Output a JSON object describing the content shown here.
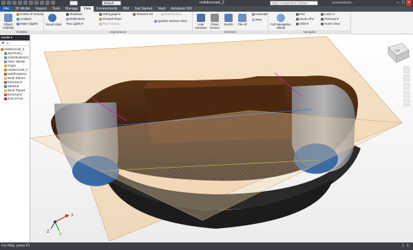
{
  "titlebar": {
    "style_value": "Default",
    "doc_title": "redukcecast_2",
    "search_placeholder": "Type a keyword or phrase",
    "user_label": "vymazania1ko..."
  },
  "tabs": [
    "3D Model",
    "Inspect",
    "Tools",
    "Manage",
    "View",
    "Environments",
    "BIM",
    "Get Started",
    "Vault",
    "Autodesk 360"
  ],
  "active_tab": "View",
  "file_tab": "File",
  "ribbon": {
    "visibility": {
      "object_visibility": "Object Visibility",
      "center_gravity": "Center of Gravity",
      "analysis": "Analysis",
      "ucs": "iMate Glyphs",
      "title": "Visibility"
    },
    "appearance": {
      "visual_style": "Visual Style",
      "shadows": "Shadows",
      "reflections": "Reflections",
      "two_lights": "Two Lights",
      "orthographic": "Orthographic",
      "ground_plane": "Ground Plane",
      "ray_tracing": "Ray Tracing",
      "textures_on": "Textures On",
      "illuminations": "Illuminations",
      "quarter_section": "Quarter Section View",
      "title": "Appearance"
    },
    "windows": {
      "user_interface": "User Interface",
      "clean_screen": "Clean Screen",
      "switch": "Switch",
      "tile_all": "Tile All",
      "cascade": "Cascade",
      "new": "New",
      "title": "Windows"
    },
    "navigate": {
      "full_nav_wheel": "Full Navigation Wheel",
      "pan": "Pan",
      "zoom_all": "Zoom All",
      "orbit": "Orbit",
      "look_at": "Look At",
      "previous": "Previous",
      "home_view": "Home View",
      "title": "Navigate"
    }
  },
  "browser": {
    "header": "Model",
    "items": [
      "redukcecast_2",
      "Std Pentry",
      "Solid Bodies(1)",
      "View: Master",
      "Origin",
      "redukcecast_2",
      "MoldFeature1",
      "Work Plane1",
      "Extrusion1",
      "Sketch3",
      "Work Plane2",
      "Extrusion2",
      "End of Part"
    ]
  },
  "viewcube": {
    "face_label": "TOP"
  },
  "triad": {
    "x": "X",
    "y": "Y",
    "z": "Z"
  },
  "status": {
    "text": "For Help, press F1",
    "count1": "1",
    "count2": "1"
  }
}
